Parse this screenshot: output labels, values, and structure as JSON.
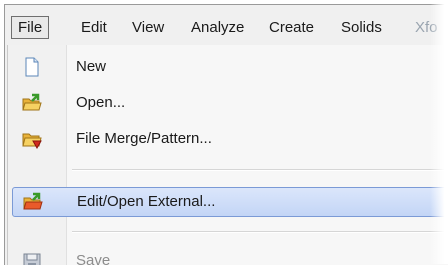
{
  "menubar": {
    "items": [
      {
        "label": "File",
        "active": true
      },
      {
        "label": "Edit"
      },
      {
        "label": "View"
      },
      {
        "label": "Analyze"
      },
      {
        "label": "Create"
      },
      {
        "label": "Solids"
      },
      {
        "label": "Xfo"
      }
    ]
  },
  "file_menu": {
    "items": [
      {
        "label": "New",
        "icon": "new-document-icon"
      },
      {
        "label": "Open...",
        "icon": "open-folder-icon"
      },
      {
        "label": "File Merge/Pattern...",
        "icon": "folder-merge-icon"
      },
      {
        "label": "Edit/Open External...",
        "icon": "open-external-icon",
        "selected": true
      },
      {
        "label": "Save",
        "icon": "save-disk-icon",
        "disabled": true
      }
    ]
  },
  "colors": {
    "selection": "#c3d5f6",
    "selection_border": "#7b9ad6"
  }
}
